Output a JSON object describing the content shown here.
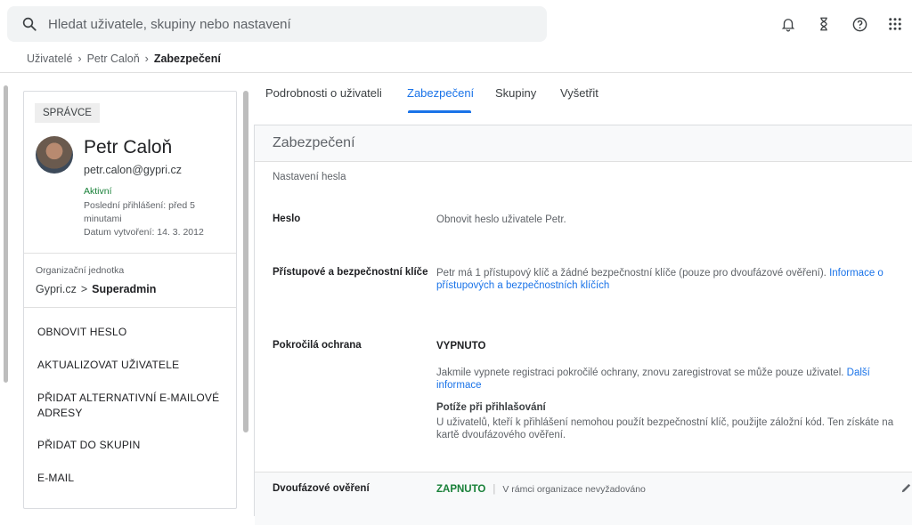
{
  "search": {
    "placeholder": "Hledat uživatele, skupiny nebo nastavení"
  },
  "icons": {
    "search": "search-icon",
    "notifications": "bell-icon",
    "tasks": "hourglass-icon",
    "help": "help-icon",
    "apps": "apps-grid-icon",
    "edit": "pencil-icon"
  },
  "breadcrumb": {
    "items": [
      "Uživatelé",
      "Petr Caloň"
    ],
    "current": "Zabezpečení"
  },
  "user": {
    "role": "SPRÁVCE",
    "name": "Petr Caloň",
    "email": "petr.calon@gypri.cz",
    "status": "Aktivní",
    "last_login": "Poslední přihlášení: před 5 minutami",
    "created": "Datum vytvoření: 14. 3. 2012",
    "org_label": "Organizační jednotka",
    "org_parent": "Gypri.cz",
    "org_current": "Superadmin"
  },
  "actions": [
    "OBNOVIT HESLO",
    "AKTUALIZOVAT UŽIVATELE",
    "PŘIDAT ALTERNATIVNÍ E-MAILOVÉ ADRESY",
    "PŘIDAT DO SKUPIN",
    "E-MAIL"
  ],
  "tabs": [
    "Podrobnosti o uživateli",
    "Zabezpečení",
    "Skupiny",
    "Vyšetřit"
  ],
  "panel": {
    "title": "Zabezpečení",
    "password_section": "Nastavení hesla",
    "password_label": "Heslo",
    "password_value": "Obnovit heslo uživatele Petr.",
    "keys_label": "Přístupové a bezpečnostní klíče",
    "keys_text": "Petr má 1 přístupový klíč a žádné bezpečnostní klíče (pouze pro dvoufázové ověření).",
    "keys_link": "Informace o přístupových a bezpečnostních klíčích",
    "adv_label": "Pokročilá ochrana",
    "adv_status": "VYPNUTO",
    "adv_text": "Jakmile vypnete registraci pokročilé ochrany, znovu zaregistrovat se může pouze uživatel.",
    "adv_link": "Další informace",
    "trouble_title": "Potíže při přihlašování",
    "trouble_text": "U uživatelů, kteří k přihlášení nemohou použít bezpečnostní klíč, použijte záložní kód. Ten získáte na kartě dvoufázového ověření.",
    "twofa_label": "Dvoufázové ověření",
    "twofa_status": "ZAPNUTO",
    "twofa_note": "V rámci organizace nevyžadováno"
  },
  "colors": {
    "accent": "#1a73e8",
    "success": "#188038"
  }
}
